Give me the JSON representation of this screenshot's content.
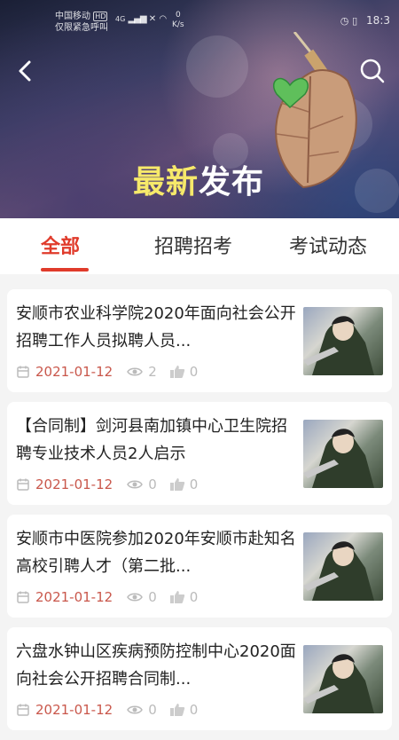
{
  "status": {
    "carrier_line1": "中国移动",
    "carrier_badge": "HD",
    "carrier_line2": "仅限紧急呼叫",
    "network": "4G",
    "speed_value": "0",
    "speed_unit": "K/s",
    "right": "18:3"
  },
  "hero": {
    "title_part1": "最新",
    "title_part2": "发布"
  },
  "tabs": [
    {
      "label": "全部",
      "active": true
    },
    {
      "label": "招聘招考",
      "active": false
    },
    {
      "label": "考试动态",
      "active": false
    }
  ],
  "articles": [
    {
      "title": "安顺市农业科学院2020年面向社会公开招聘工作人员拟聘人员...",
      "date": "2021-01-12",
      "views": "2",
      "likes": "0"
    },
    {
      "title": "【合同制】剑河县南加镇中心卫生院招聘专业技术人员2人启示",
      "date": "2021-01-12",
      "views": "0",
      "likes": "0"
    },
    {
      "title": "安顺市中医院参加2020年安顺市赴知名高校引聘人才（第二批...",
      "date": "2021-01-12",
      "views": "0",
      "likes": "0"
    },
    {
      "title": "六盘水钟山区疾病预防控制中心2020面向社会公开招聘合同制...",
      "date": "2021-01-12",
      "views": "0",
      "likes": "0"
    }
  ]
}
